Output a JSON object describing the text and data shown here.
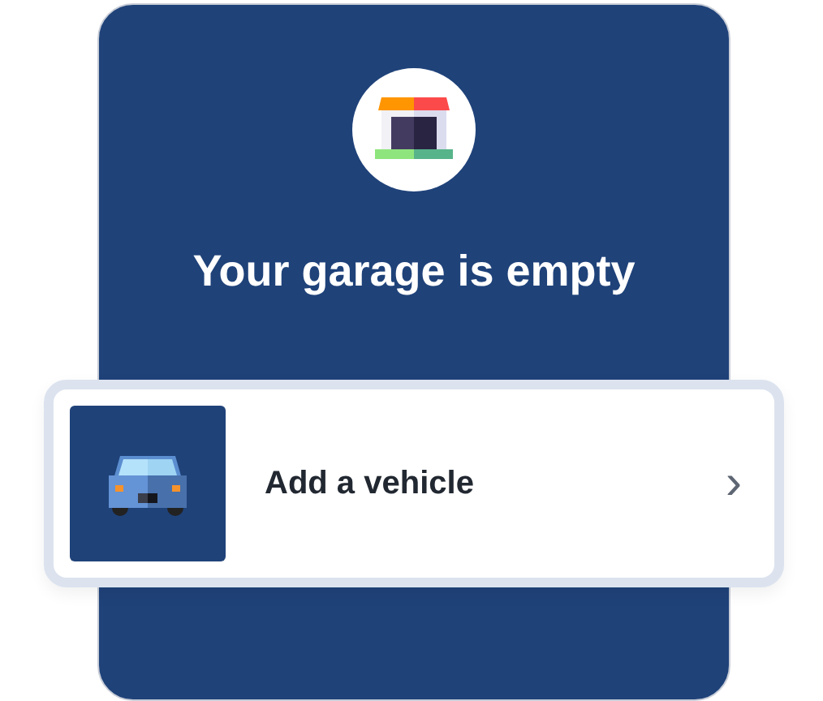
{
  "empty_state": {
    "title": "Your garage is empty"
  },
  "action": {
    "label": "Add a vehicle",
    "chevron": "›"
  }
}
